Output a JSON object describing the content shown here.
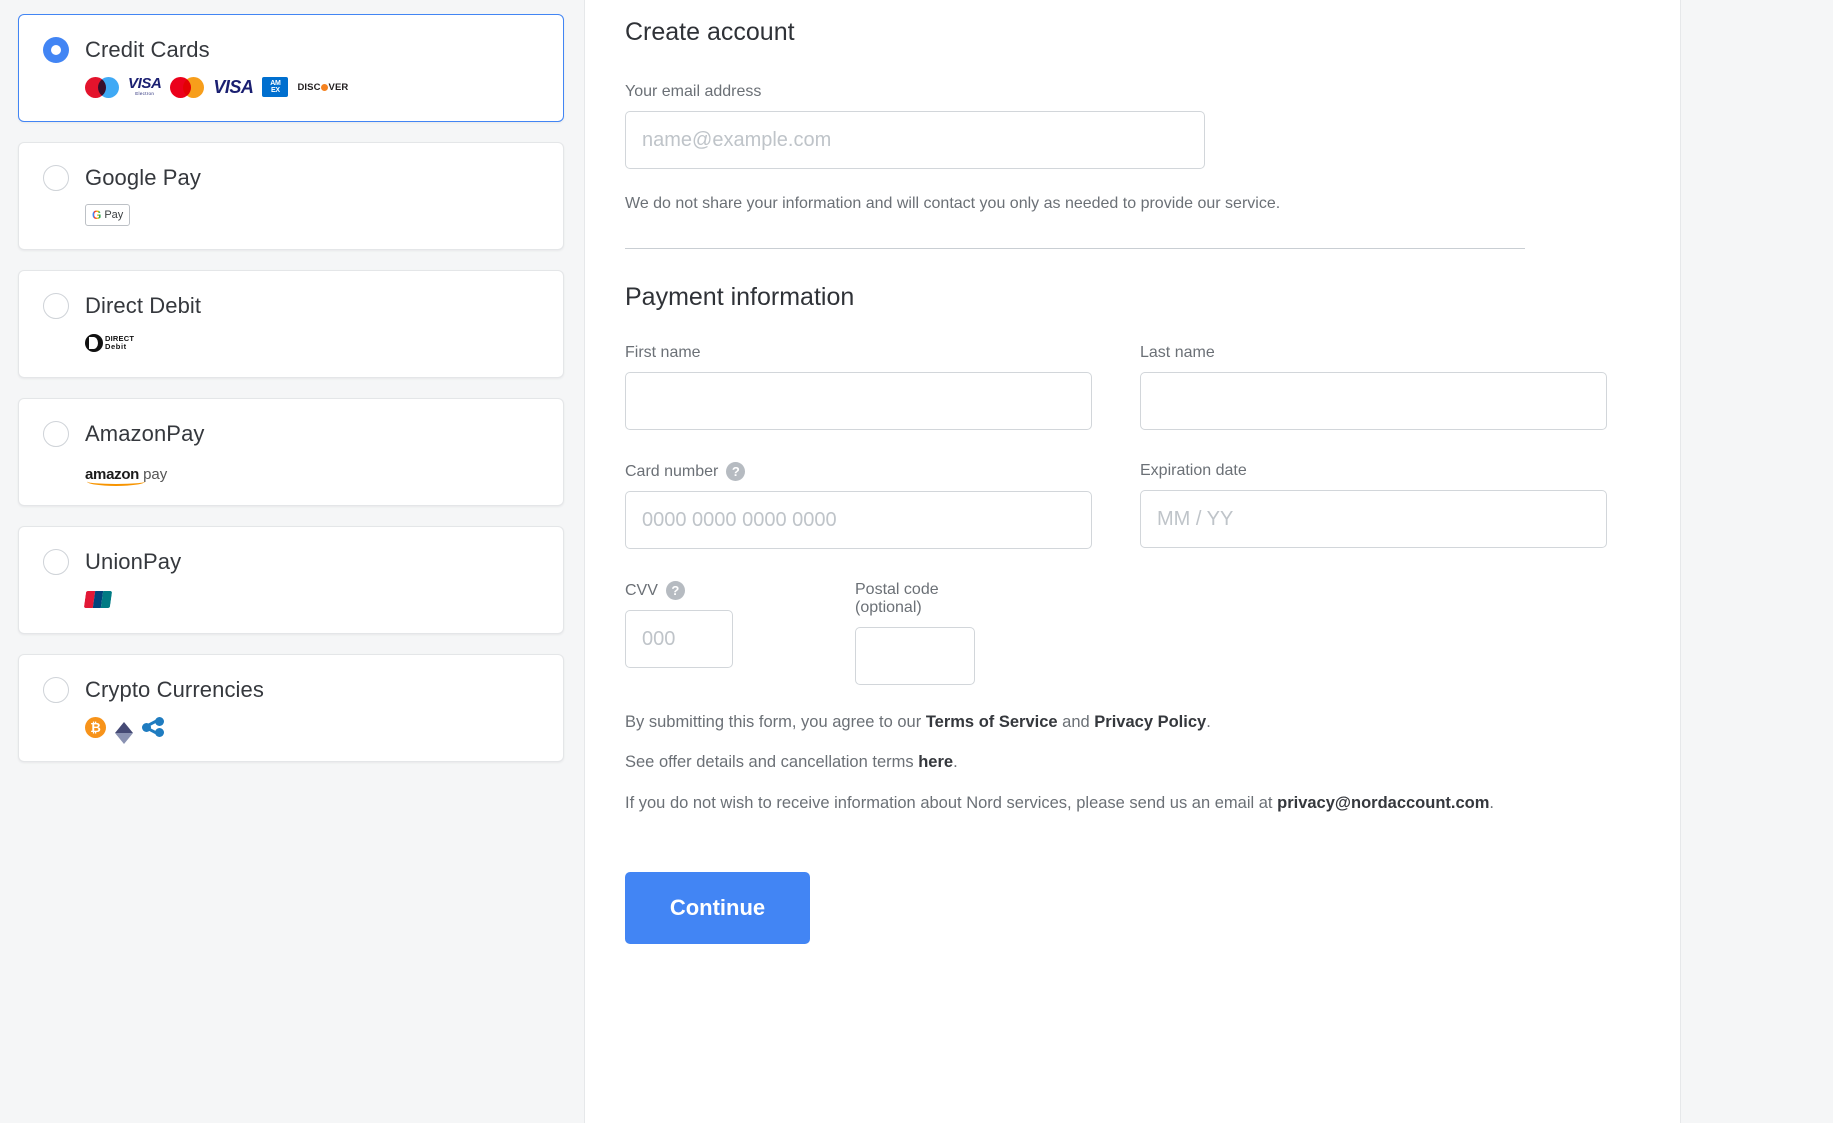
{
  "colors": {
    "accent": "#4285f4",
    "page_bg": "#f5f6f7",
    "panel_bg": "#ffffff",
    "label_text": "#6b7076",
    "heading_text": "#2f3237",
    "border": "#d2d6da"
  },
  "payment_methods": {
    "items": [
      {
        "id": "credit-cards",
        "label": "Credit Cards",
        "selected": true,
        "brands": [
          "maestro",
          "visa-electron",
          "mastercard",
          "visa",
          "amex",
          "discover"
        ],
        "brand_labels": {
          "visa": "VISA",
          "visa_electron_sub": "Electron",
          "amex_line1": "AM",
          "amex_line2": "EX",
          "discover": "DISC VER"
        }
      },
      {
        "id": "google-pay",
        "label": "Google Pay",
        "selected": false,
        "brands": [
          "gpay"
        ],
        "brand_labels": {
          "g": "G",
          "pay": "Pay"
        }
      },
      {
        "id": "direct-debit",
        "label": "Direct Debit",
        "selected": false,
        "brands": [
          "direct-debit"
        ],
        "brand_labels": {
          "line1": "DIRECT",
          "line2": "Debit"
        }
      },
      {
        "id": "amazon-pay",
        "label": "AmazonPay",
        "selected": false,
        "brands": [
          "amazonpay"
        ],
        "brand_labels": {
          "amazon": "amazon",
          "pay": "pay"
        }
      },
      {
        "id": "unionpay",
        "label": "UnionPay",
        "selected": false,
        "brands": [
          "unionpay"
        ],
        "brand_labels": {}
      },
      {
        "id": "crypto-currencies",
        "label": "Crypto Currencies",
        "selected": false,
        "brands": [
          "bitcoin",
          "ethereum",
          "ripple"
        ],
        "brand_labels": {
          "btc": "₿"
        }
      }
    ]
  },
  "account": {
    "title": "Create account",
    "email_label": "Your email address",
    "email_value": "",
    "email_placeholder": "name@example.com",
    "privacy_note": "We do not share your information and will contact you only as needed to provide our service."
  },
  "payment_information": {
    "title": "Payment information",
    "fields": {
      "first_name": {
        "label": "First name",
        "value": "",
        "placeholder": ""
      },
      "last_name": {
        "label": "Last name",
        "value": "",
        "placeholder": ""
      },
      "card_number": {
        "label": "Card number",
        "value": "",
        "placeholder": "0000 0000 0000 0000",
        "help": "?"
      },
      "expiration_date": {
        "label": "Expiration date",
        "value": "",
        "placeholder": "MM / YY"
      },
      "cvv": {
        "label": "CVV",
        "value": "",
        "placeholder": "000",
        "help": "?"
      },
      "postal_code": {
        "label": "Postal code (optional)",
        "value": "",
        "placeholder": ""
      }
    }
  },
  "legal": {
    "line1_prefix": "By submitting this form, you agree to our ",
    "terms_link": "Terms of Service",
    "line1_mid": " and ",
    "privacy_link": "Privacy Policy",
    "line1_suffix": ".",
    "line2_prefix": "See offer details and cancellation terms ",
    "here_link": "here",
    "line2_suffix": ".",
    "line3_prefix": "If you do not wish to receive information about Nord services, please send us an email at ",
    "email_link": "privacy@nordaccount.com",
    "line3_suffix": "."
  },
  "actions": {
    "continue_label": "Continue"
  }
}
